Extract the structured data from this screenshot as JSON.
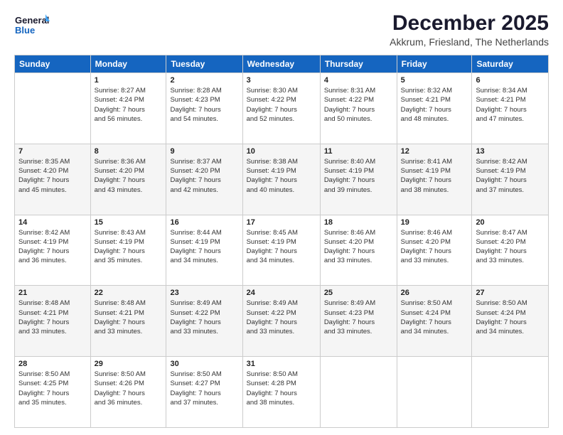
{
  "logo": {
    "line1": "General",
    "line2": "Blue"
  },
  "title": "December 2025",
  "subtitle": "Akkrum, Friesland, The Netherlands",
  "days_of_week": [
    "Sunday",
    "Monday",
    "Tuesday",
    "Wednesday",
    "Thursday",
    "Friday",
    "Saturday"
  ],
  "weeks": [
    [
      {
        "day": "",
        "info": ""
      },
      {
        "day": "1",
        "info": "Sunrise: 8:27 AM\nSunset: 4:24 PM\nDaylight: 7 hours\nand 56 minutes."
      },
      {
        "day": "2",
        "info": "Sunrise: 8:28 AM\nSunset: 4:23 PM\nDaylight: 7 hours\nand 54 minutes."
      },
      {
        "day": "3",
        "info": "Sunrise: 8:30 AM\nSunset: 4:22 PM\nDaylight: 7 hours\nand 52 minutes."
      },
      {
        "day": "4",
        "info": "Sunrise: 8:31 AM\nSunset: 4:22 PM\nDaylight: 7 hours\nand 50 minutes."
      },
      {
        "day": "5",
        "info": "Sunrise: 8:32 AM\nSunset: 4:21 PM\nDaylight: 7 hours\nand 48 minutes."
      },
      {
        "day": "6",
        "info": "Sunrise: 8:34 AM\nSunset: 4:21 PM\nDaylight: 7 hours\nand 47 minutes."
      }
    ],
    [
      {
        "day": "7",
        "info": "Sunrise: 8:35 AM\nSunset: 4:20 PM\nDaylight: 7 hours\nand 45 minutes."
      },
      {
        "day": "8",
        "info": "Sunrise: 8:36 AM\nSunset: 4:20 PM\nDaylight: 7 hours\nand 43 minutes."
      },
      {
        "day": "9",
        "info": "Sunrise: 8:37 AM\nSunset: 4:20 PM\nDaylight: 7 hours\nand 42 minutes."
      },
      {
        "day": "10",
        "info": "Sunrise: 8:38 AM\nSunset: 4:19 PM\nDaylight: 7 hours\nand 40 minutes."
      },
      {
        "day": "11",
        "info": "Sunrise: 8:40 AM\nSunset: 4:19 PM\nDaylight: 7 hours\nand 39 minutes."
      },
      {
        "day": "12",
        "info": "Sunrise: 8:41 AM\nSunset: 4:19 PM\nDaylight: 7 hours\nand 38 minutes."
      },
      {
        "day": "13",
        "info": "Sunrise: 8:42 AM\nSunset: 4:19 PM\nDaylight: 7 hours\nand 37 minutes."
      }
    ],
    [
      {
        "day": "14",
        "info": "Sunrise: 8:42 AM\nSunset: 4:19 PM\nDaylight: 7 hours\nand 36 minutes."
      },
      {
        "day": "15",
        "info": "Sunrise: 8:43 AM\nSunset: 4:19 PM\nDaylight: 7 hours\nand 35 minutes."
      },
      {
        "day": "16",
        "info": "Sunrise: 8:44 AM\nSunset: 4:19 PM\nDaylight: 7 hours\nand 34 minutes."
      },
      {
        "day": "17",
        "info": "Sunrise: 8:45 AM\nSunset: 4:19 PM\nDaylight: 7 hours\nand 34 minutes."
      },
      {
        "day": "18",
        "info": "Sunrise: 8:46 AM\nSunset: 4:20 PM\nDaylight: 7 hours\nand 33 minutes."
      },
      {
        "day": "19",
        "info": "Sunrise: 8:46 AM\nSunset: 4:20 PM\nDaylight: 7 hours\nand 33 minutes."
      },
      {
        "day": "20",
        "info": "Sunrise: 8:47 AM\nSunset: 4:20 PM\nDaylight: 7 hours\nand 33 minutes."
      }
    ],
    [
      {
        "day": "21",
        "info": "Sunrise: 8:48 AM\nSunset: 4:21 PM\nDaylight: 7 hours\nand 33 minutes."
      },
      {
        "day": "22",
        "info": "Sunrise: 8:48 AM\nSunset: 4:21 PM\nDaylight: 7 hours\nand 33 minutes."
      },
      {
        "day": "23",
        "info": "Sunrise: 8:49 AM\nSunset: 4:22 PM\nDaylight: 7 hours\nand 33 minutes."
      },
      {
        "day": "24",
        "info": "Sunrise: 8:49 AM\nSunset: 4:22 PM\nDaylight: 7 hours\nand 33 minutes."
      },
      {
        "day": "25",
        "info": "Sunrise: 8:49 AM\nSunset: 4:23 PM\nDaylight: 7 hours\nand 33 minutes."
      },
      {
        "day": "26",
        "info": "Sunrise: 8:50 AM\nSunset: 4:24 PM\nDaylight: 7 hours\nand 34 minutes."
      },
      {
        "day": "27",
        "info": "Sunrise: 8:50 AM\nSunset: 4:24 PM\nDaylight: 7 hours\nand 34 minutes."
      }
    ],
    [
      {
        "day": "28",
        "info": "Sunrise: 8:50 AM\nSunset: 4:25 PM\nDaylight: 7 hours\nand 35 minutes."
      },
      {
        "day": "29",
        "info": "Sunrise: 8:50 AM\nSunset: 4:26 PM\nDaylight: 7 hours\nand 36 minutes."
      },
      {
        "day": "30",
        "info": "Sunrise: 8:50 AM\nSunset: 4:27 PM\nDaylight: 7 hours\nand 37 minutes."
      },
      {
        "day": "31",
        "info": "Sunrise: 8:50 AM\nSunset: 4:28 PM\nDaylight: 7 hours\nand 38 minutes."
      },
      {
        "day": "",
        "info": ""
      },
      {
        "day": "",
        "info": ""
      },
      {
        "day": "",
        "info": ""
      }
    ]
  ]
}
